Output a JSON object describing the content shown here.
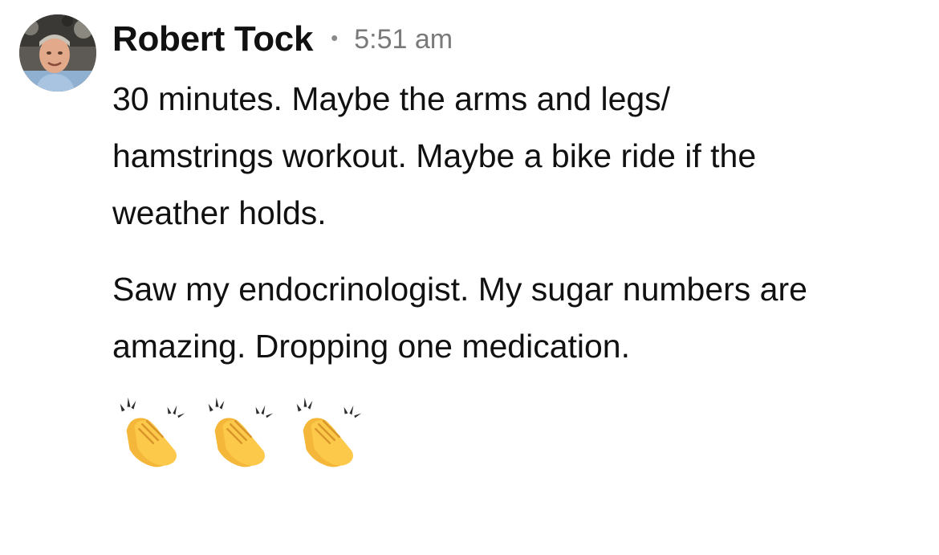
{
  "post": {
    "author": "Robert Tock",
    "separator": "•",
    "time": "5:51 am",
    "avatar_icon": "profile-photo",
    "paragraphs": [
      "30 minutes. Maybe the arms and legs/ hamstrings workout. Maybe a bike ride if the weather holds.",
      "Saw my endocrinologist. My sugar numbers are amazing. Dropping one medication."
    ],
    "emoji": [
      "clapping-hands-emoji",
      "clapping-hands-emoji",
      "clapping-hands-emoji"
    ]
  }
}
